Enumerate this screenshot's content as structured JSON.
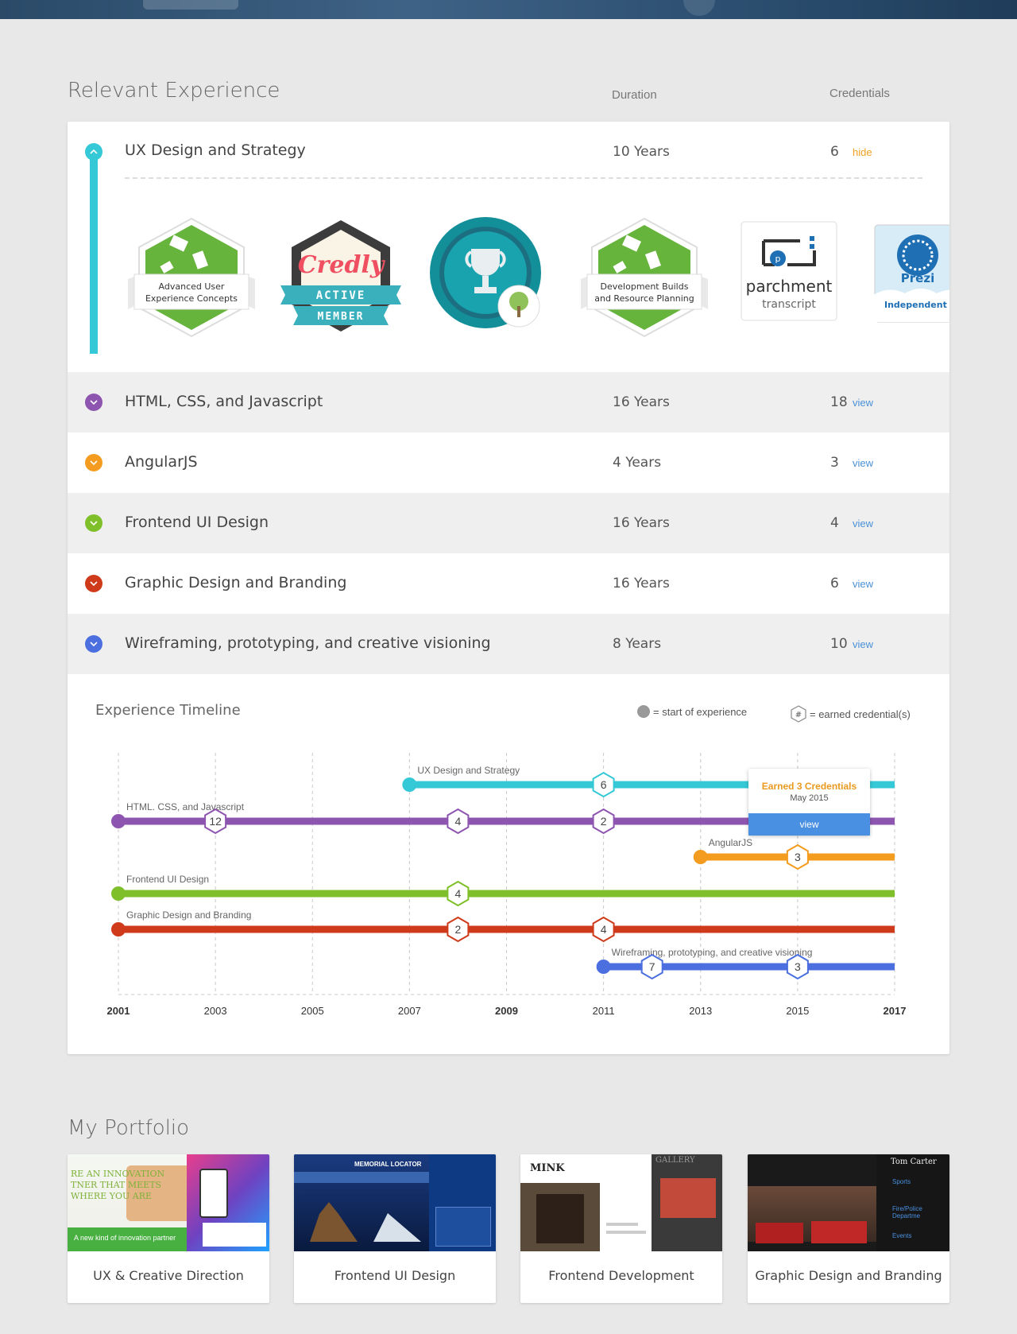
{
  "experience": {
    "title": "Relevant Experience",
    "duration_header": "Duration",
    "credentials_header": "Credentials",
    "rows": [
      {
        "name": "UX Design and Strategy",
        "duration": "10 Years",
        "count": "6",
        "link": "hide",
        "color": "#35c8d6"
      },
      {
        "name": "HTML, CSS, and Javascript",
        "duration": "16 Years",
        "count": "18",
        "link": "view",
        "color": "#8e55b0"
      },
      {
        "name": "AngularJS",
        "duration": "4 Years",
        "count": "3",
        "link": "view",
        "color": "#f39c1f"
      },
      {
        "name": "Frontend UI Design",
        "duration": "16 Years",
        "count": "4",
        "link": "view",
        "color": "#7fc02a"
      },
      {
        "name": "Graphic Design and Branding",
        "duration": "16 Years",
        "count": "6",
        "link": "view",
        "color": "#cf3a1a"
      },
      {
        "name": "Wireframing, prototyping, and creative visioning",
        "duration": "8 Years",
        "count": "10",
        "link": "view",
        "color": "#4c6fe0"
      }
    ],
    "badges": {
      "advanced_ux": [
        "Advanced User",
        "Experience Concepts"
      ],
      "credly": {
        "word": "Credly",
        "ribbon1": "ACTIVE",
        "ribbon2": "MEMBER"
      },
      "dev_builds": [
        "Development Builds",
        "and Resource Planning"
      ],
      "parchment": {
        "word": "parchment",
        "sub": "transcript"
      },
      "prezi": {
        "word": "Prezi",
        "sub": "Independent Exp"
      }
    }
  },
  "timeline": {
    "title": "Experience Timeline",
    "legend_start": "= start of experience",
    "legend_hash": "#",
    "legend_credential": "= earned credential(s)",
    "years": [
      "2001",
      "2003",
      "2005",
      "2007",
      "2009",
      "2011",
      "2013",
      "2015",
      "2017"
    ],
    "bold_years": [
      "2001",
      "2009",
      "2017"
    ],
    "tracks": [
      {
        "label": "UX Design and Strategy",
        "start": 2007.0,
        "color": "#35c8d6",
        "marks": [
          {
            "year": 2011,
            "n": "6"
          }
        ]
      },
      {
        "label": "HTML. CSS, and Javascript",
        "start": 2001.0,
        "color": "#8e55b0",
        "marks": [
          {
            "year": 2003,
            "n": "12"
          },
          {
            "year": 2008,
            "n": "4"
          },
          {
            "year": 2011,
            "n": "2"
          }
        ]
      },
      {
        "label": "AngularJS",
        "start": 2013.0,
        "color": "#f39c1f",
        "marks": [
          {
            "year": 2015,
            "n": "3"
          }
        ]
      },
      {
        "label": "Frontend UI Design",
        "start": 2001.0,
        "color": "#7fc02a",
        "marks": [
          {
            "year": 2008,
            "n": "4"
          }
        ]
      },
      {
        "label": "Graphic Design and Branding",
        "start": 2001.0,
        "color": "#cf3a1a",
        "marks": [
          {
            "year": 2008,
            "n": "2"
          },
          {
            "year": 2011,
            "n": "4"
          }
        ]
      },
      {
        "label": "Wireframing, prototyping, and creative visioning",
        "start": 2011.0,
        "color": "#4c6fe0",
        "marks": [
          {
            "year": 2012,
            "n": "7"
          },
          {
            "year": 2015,
            "n": "3"
          }
        ]
      }
    ],
    "tooltip": {
      "title": "Earned 3 Credentials",
      "date": "May 2015",
      "button": "view"
    }
  },
  "portfolio": {
    "title": "My Portfolio",
    "items": [
      {
        "caption": "UX & Creative Direction",
        "thumb_lines": [
          "RE AN INNOVATION",
          "TNER THAT MEETS",
          "WHERE YOU ARE"
        ],
        "footer": "A new kind of innovation partner"
      },
      {
        "caption": "Frontend UI Design",
        "thumb_lines": [
          "MEMORIAL LOCATOR"
        ]
      },
      {
        "caption": "Frontend Development",
        "thumb_lines": [
          "MINK",
          "GALLERY"
        ]
      },
      {
        "caption": "Graphic Design and Branding",
        "thumb_lines": [
          "Tom Carter",
          "Sports",
          "Fire/Police Departme",
          "Events"
        ]
      }
    ]
  }
}
